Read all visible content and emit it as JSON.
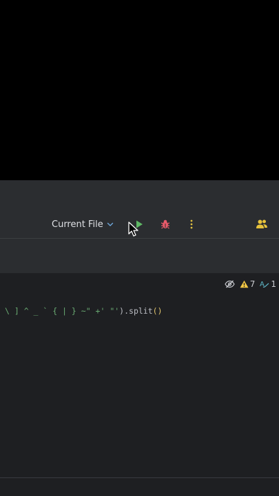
{
  "toolbar": {
    "run_config_label": "Current File",
    "icons": {
      "chevron": "chevron-down-icon",
      "run": "play-icon",
      "debug": "bug-icon",
      "more": "more-vertical-icon",
      "collab": "users-icon"
    },
    "colors": {
      "run": "#5fb865",
      "debug": "#e85a6a",
      "more": "#e0c040",
      "collab": "#e8c33b",
      "chevron": "#6fa8dc"
    }
  },
  "editor": {
    "inspections": {
      "warnings": "7",
      "typos": "1"
    },
    "code": {
      "string_part": "\\ ] ^ _ ` { | } ~\" +' \"'",
      "call_part": ").split",
      "parens": "()"
    }
  }
}
